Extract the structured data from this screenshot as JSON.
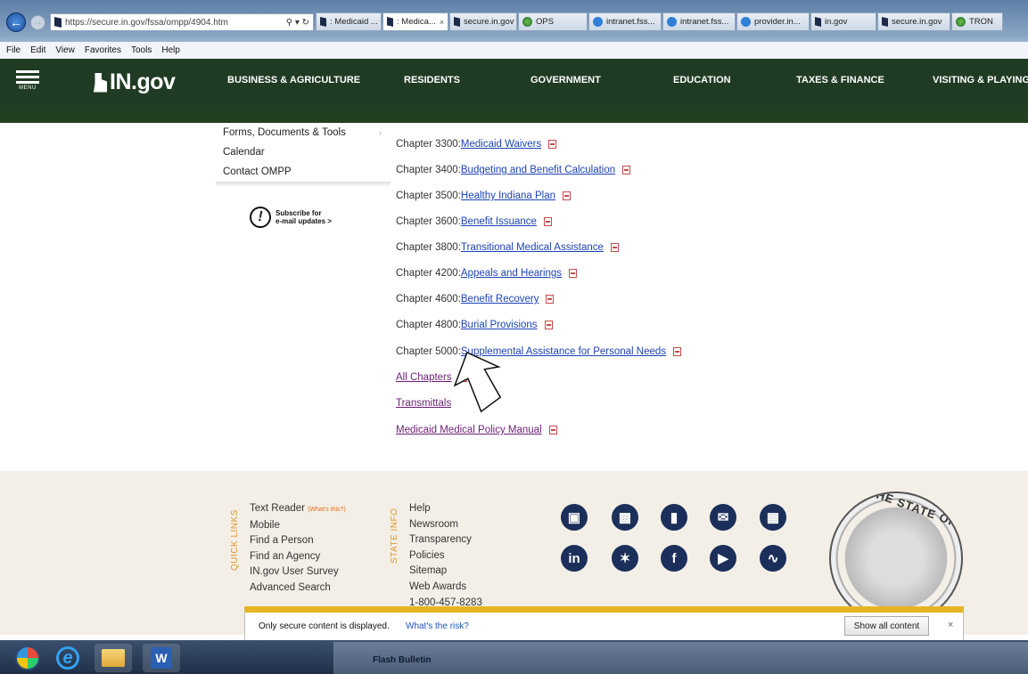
{
  "browser": {
    "url": "https://secure.in.gov/fssa/ompp/4904.htm",
    "tabs": [
      {
        "label": ": Medicaid ...",
        "icon": "indiana-icon",
        "active": false
      },
      {
        "label": ": Medica...",
        "icon": "indiana-icon",
        "active": true
      },
      {
        "label": "secure.in.gov",
        "icon": "indiana-icon",
        "active": false
      },
      {
        "label": "OPS",
        "icon": "globe-icon",
        "active": false
      },
      {
        "label": "intranet.fss...",
        "icon": "ie-icon",
        "active": false
      },
      {
        "label": "intranet.fss...",
        "icon": "ie-icon",
        "active": false
      },
      {
        "label": "provider.in...",
        "icon": "ie-icon",
        "active": false
      },
      {
        "label": "in.gov",
        "icon": "indiana-icon",
        "active": false
      },
      {
        "label": "secure.in.gov",
        "icon": "indiana-icon",
        "active": false
      },
      {
        "label": "TRON",
        "icon": "globe-icon",
        "active": false
      }
    ],
    "menu": [
      "File",
      "Edit",
      "View",
      "Favorites",
      "Tools",
      "Help"
    ]
  },
  "header": {
    "menu_label": "MENU",
    "logo_text": "IN.gov",
    "nav": [
      "BUSINESS & AGRICULTURE",
      "RESIDENTS",
      "GOVERNMENT",
      "EDUCATION",
      "TAXES & FINANCE",
      "VISITING & PLAYING"
    ]
  },
  "leftnav": {
    "items": [
      "Forms, Documents & Tools",
      "Calendar",
      "Contact OMPP"
    ],
    "subscribe": [
      "Subscribe for",
      "e-mail updates >"
    ]
  },
  "chapters": [
    {
      "prefix": "Chapter 3300: ",
      "link": "Medicaid Waivers",
      "pdf": true,
      "visited": false
    },
    {
      "prefix": "Chapter 3400: ",
      "link": "Budgeting and Benefit Calculation",
      "pdf": true,
      "visited": false
    },
    {
      "prefix": "Chapter 3500: ",
      "link": "Healthy Indiana Plan",
      "pdf": true,
      "visited": false
    },
    {
      "prefix": "Chapter 3600: ",
      "link": "Benefit Issuance",
      "pdf": true,
      "visited": false
    },
    {
      "prefix": "Chapter 3800: ",
      "link": "Transitional Medical Assistance",
      "pdf": true,
      "visited": false
    },
    {
      "prefix": "Chapter 4200: ",
      "link": "Appeals and Hearings",
      "pdf": true,
      "visited": false
    },
    {
      "prefix": "Chapter 4600: ",
      "link": "Benefit Recovery",
      "pdf": true,
      "visited": false
    },
    {
      "prefix": "Chapter 4800: ",
      "link": "Burial Provisions",
      "pdf": true,
      "visited": false
    },
    {
      "prefix": "Chapter 5000: ",
      "link": "Supplemental Assistance for Personal Needs",
      "pdf": true,
      "visited": false
    },
    {
      "prefix": "",
      "link": "All Chapters",
      "pdf": true,
      "visited": true
    },
    {
      "prefix": "",
      "link": "Transmittals",
      "pdf": false,
      "visited": true
    },
    {
      "prefix": "",
      "link": "Medicaid Medical Policy Manual",
      "pdf": true,
      "visited": true
    }
  ],
  "footer": {
    "quick_links_label": "QUICK LINKS",
    "state_info_label": "STATE INFO",
    "text_reader": "Text Reader",
    "whats_this": "(What's this?)",
    "quick_links": [
      "Mobile",
      "Find a Person",
      "Find an Agency",
      "IN.gov User Survey",
      "Advanced Search"
    ],
    "state_info": [
      "Help",
      "Newsroom",
      "Transparency",
      "Policies",
      "Sitemap",
      "Web Awards",
      "1-800-457-8283"
    ],
    "seal_text": "THE STATE OF"
  },
  "notification": {
    "message": "Only secure content is displayed.",
    "risk_link": "What's the risk?",
    "button": "Show all content",
    "close": "×"
  },
  "taskbar": {
    "window_label": "Flash Bulletin"
  }
}
